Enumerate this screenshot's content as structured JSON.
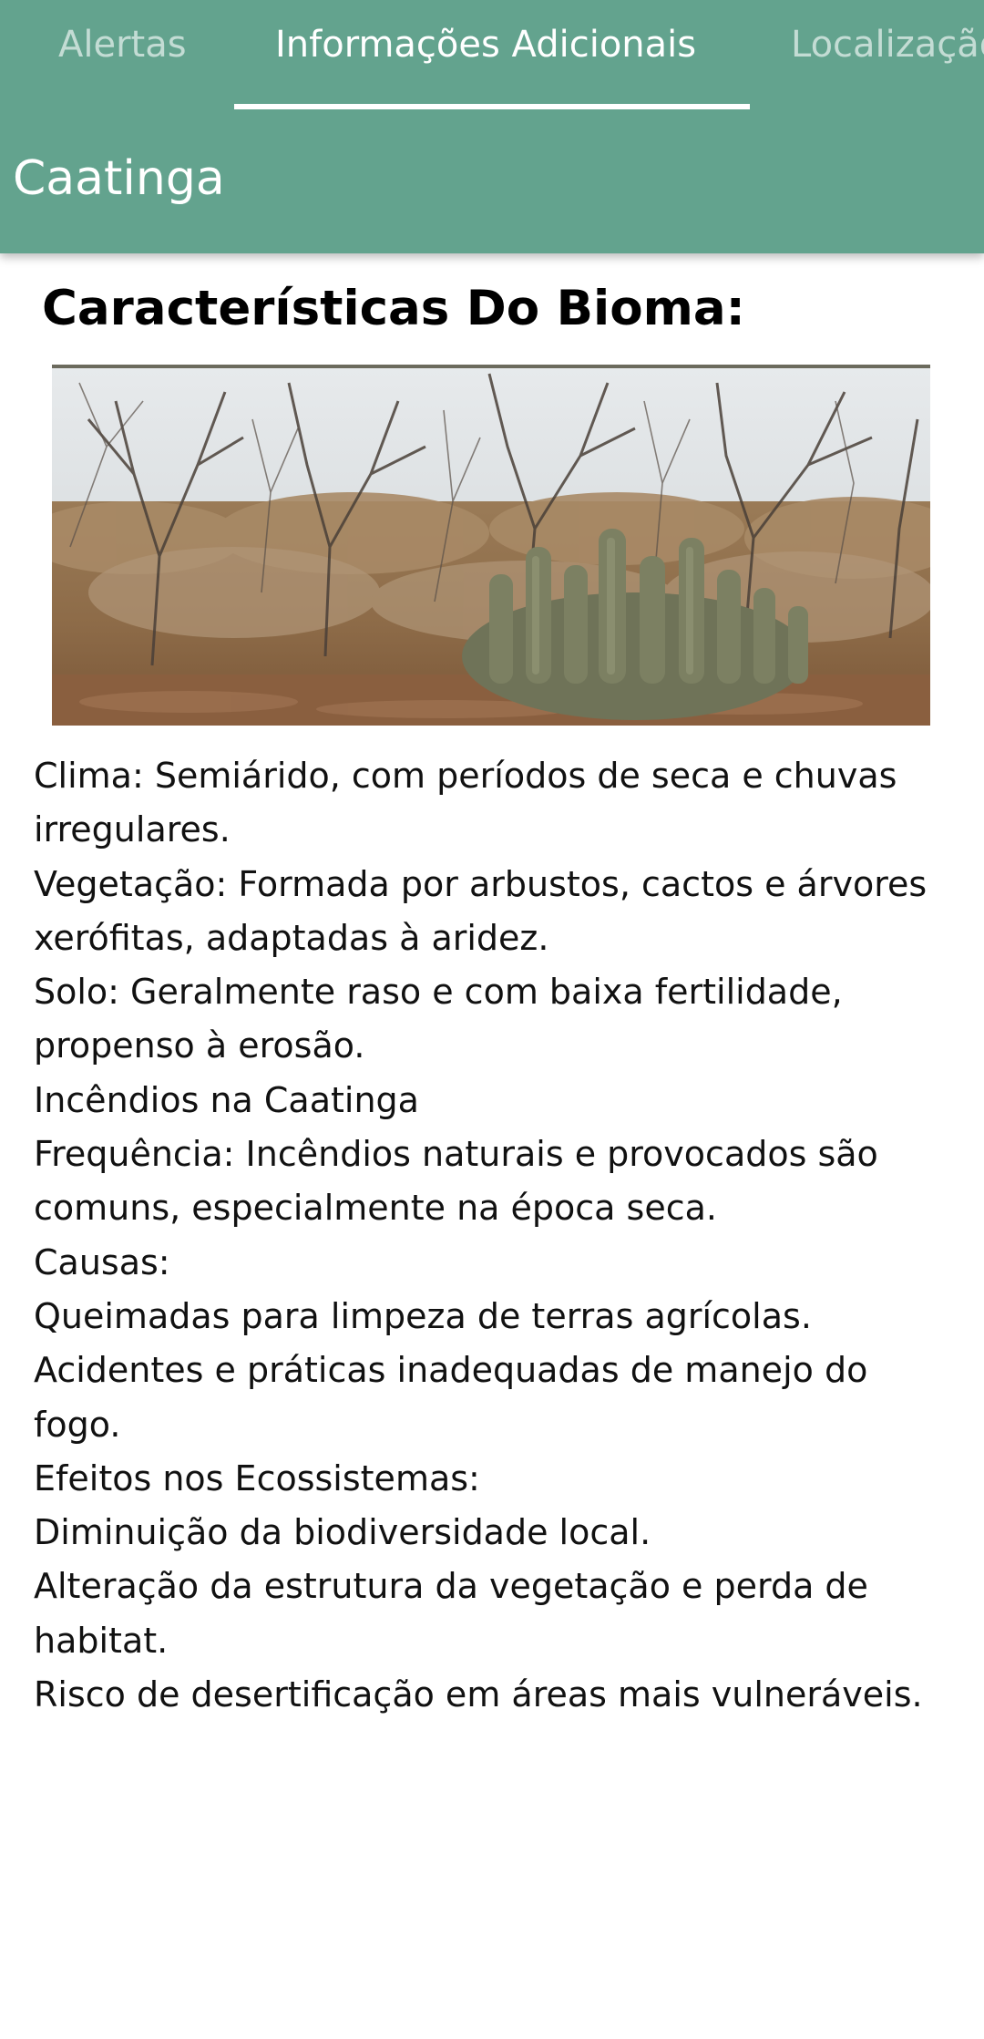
{
  "tabs": [
    {
      "label": "Alertas"
    },
    {
      "label": "Informações Adicionais"
    },
    {
      "label": "Localização"
    }
  ],
  "active_tab": "Informações Adicionais",
  "toolbar": {
    "title": "Caatinga"
  },
  "main": {
    "heading": "Características Do Bioma:",
    "paragraphs": [
      "Clima: Semiárido, com períodos de seca e chuvas irregulares.",
      "Vegetação: Formada por arbustos, cactos e árvores xerófitas, adaptadas à aridez.",
      "Solo: Geralmente raso e com baixa fertilidade, propenso à erosão.",
      "Incêndios na Caatinga",
      "Frequência: Incêndios naturais e provocados são comuns, especialmente na época seca.",
      "Causas:",
      "Queimadas para limpeza de terras agrícolas.",
      "Acidentes e práticas inadequadas de manejo do fogo.",
      "Efeitos nos Ecossistemas:",
      "Diminuição da biodiversidade local.",
      "Alteração da estrutura da vegetação e perda de habitat.",
      "Risco de desertificação em áreas mais vulneráveis."
    ]
  },
  "colors": {
    "appbar": "#63a38e",
    "tab_active": "#ffffff",
    "tab_inactive": "#c9e0d8",
    "heading": "#000000",
    "body_text": "#111111"
  }
}
